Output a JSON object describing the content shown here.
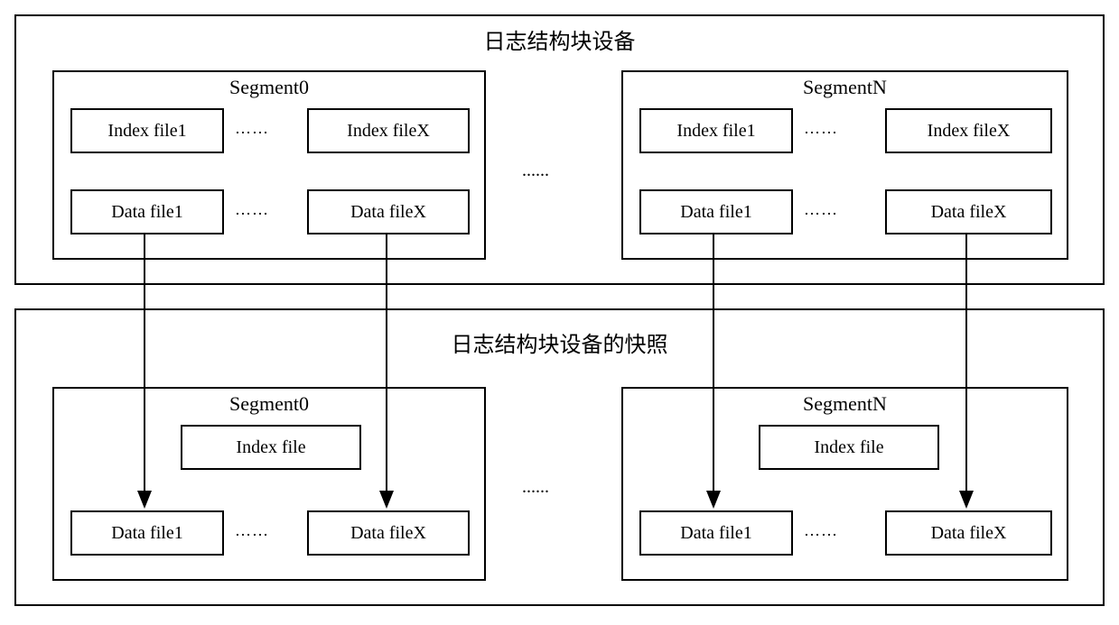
{
  "diagram": {
    "top_title": "日志结构块设备",
    "bottom_title": "日志结构块设备的快照",
    "ellipsis_small": "……",
    "ellipsis_big": "......",
    "top_segments": [
      {
        "name": "Segment0",
        "index_files": [
          "Index file1",
          "Index fileX"
        ],
        "data_files": [
          "Data file1",
          "Data fileX"
        ]
      },
      {
        "name": "SegmentN",
        "index_files": [
          "Index file1",
          "Index fileX"
        ],
        "data_files": [
          "Data file1",
          "Data fileX"
        ]
      }
    ],
    "bottom_segments": [
      {
        "name": "Segment0",
        "index_file": "Index file",
        "data_files": [
          "Data file1",
          "Data fileX"
        ]
      },
      {
        "name": "SegmentN",
        "index_file": "Index file",
        "data_files": [
          "Data file1",
          "Data fileX"
        ]
      }
    ]
  }
}
